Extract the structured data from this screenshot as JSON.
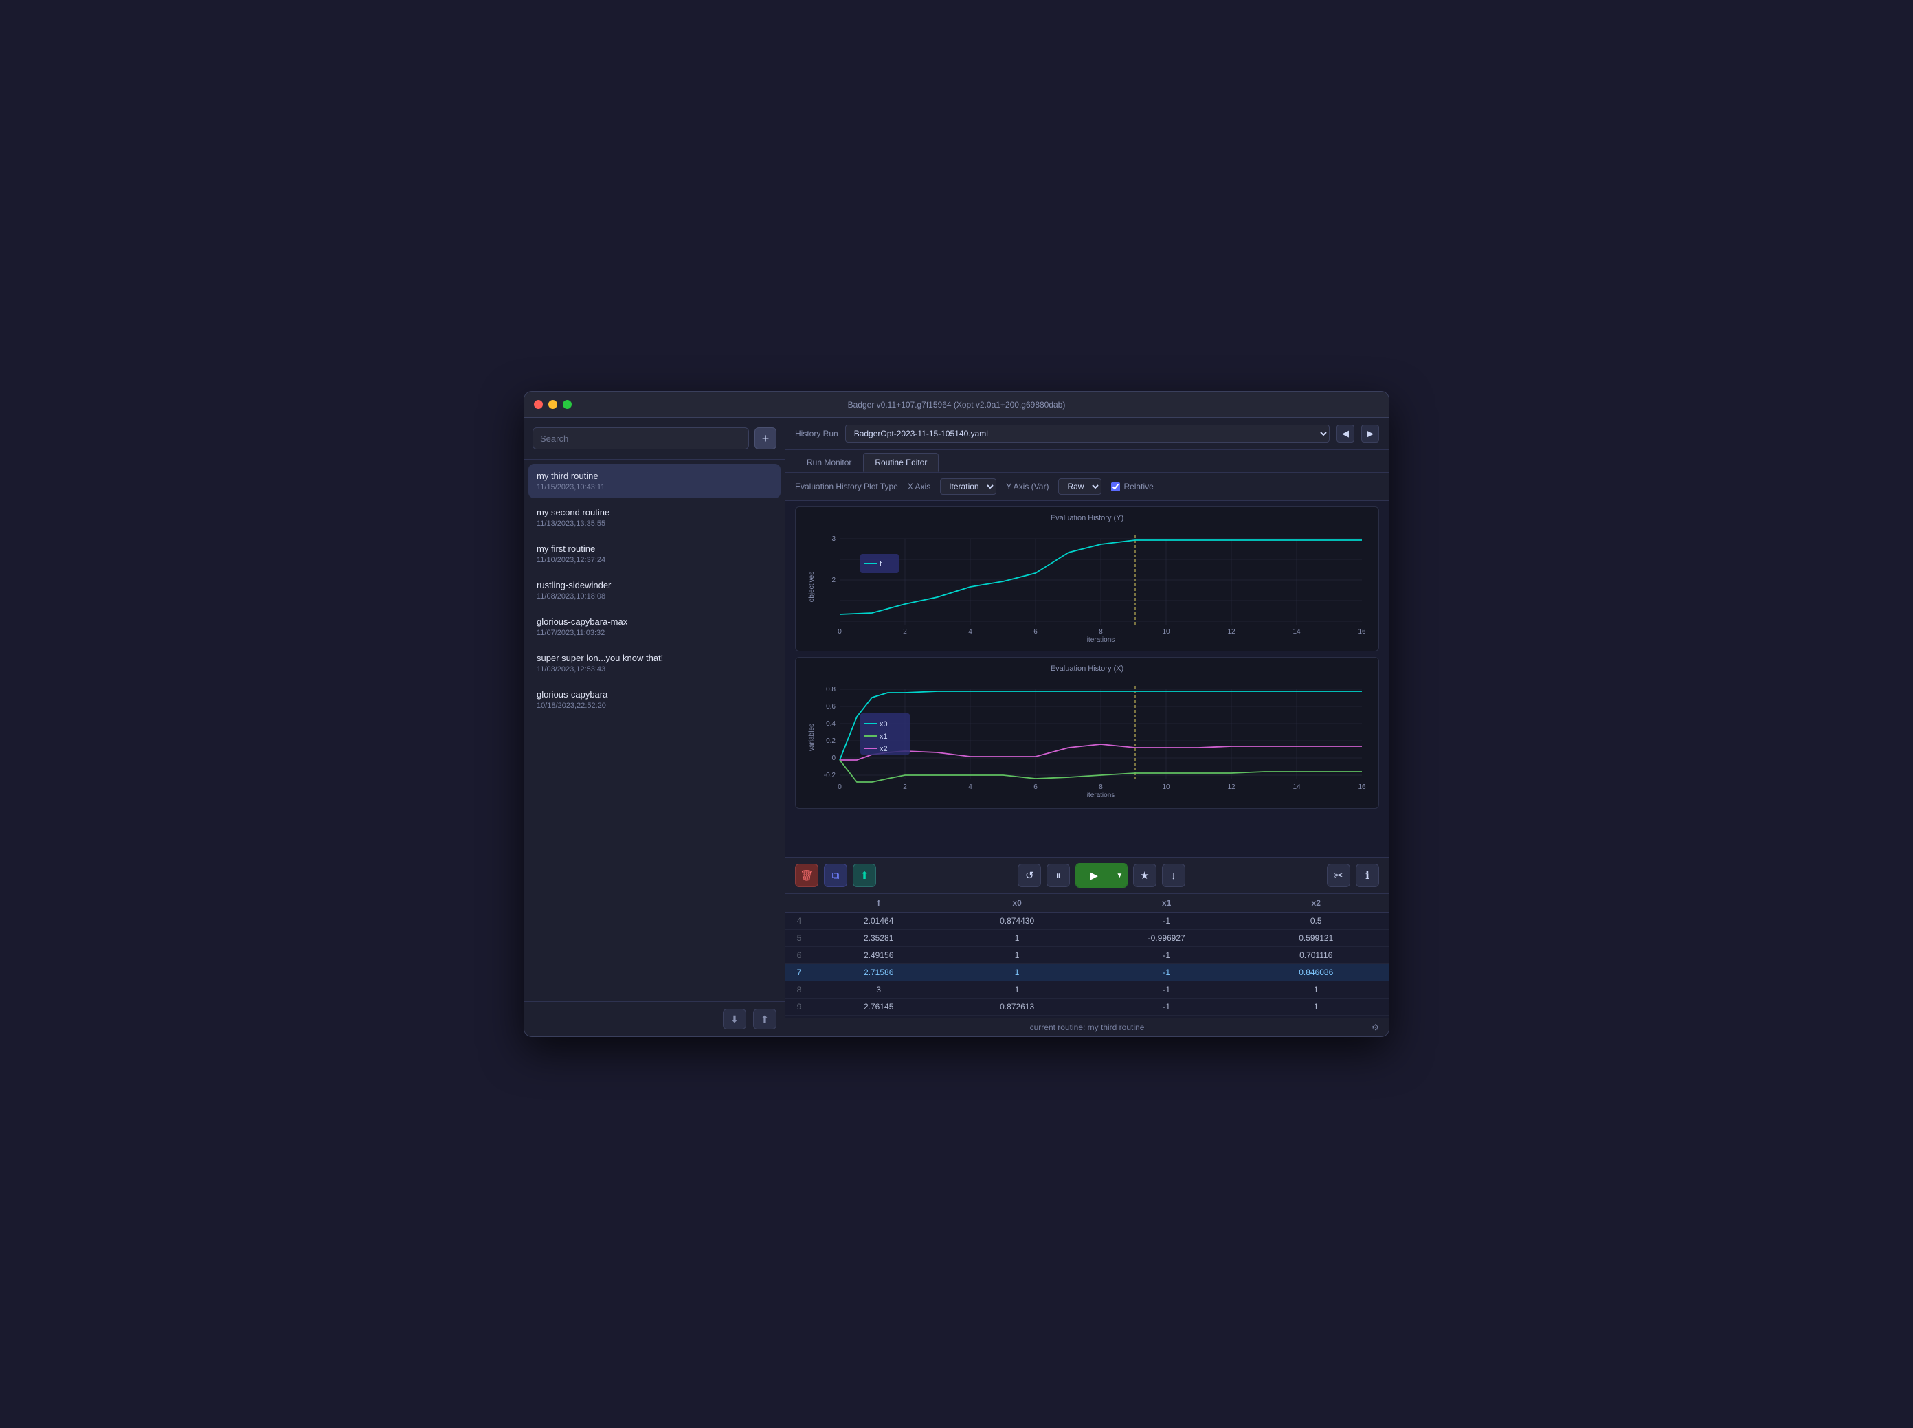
{
  "window": {
    "title": "Badger v0.11+107.g7f15964 (Xopt v2.0a1+200.g69880dab)"
  },
  "sidebar": {
    "search_placeholder": "Search",
    "add_btn_label": "+",
    "routines": [
      {
        "name": "my third routine",
        "date": "11/15/2023,10:43:11",
        "active": true
      },
      {
        "name": "my second routine",
        "date": "11/13/2023,13:35:55",
        "active": false
      },
      {
        "name": "my first routine",
        "date": "11/10/2023,12:37:24",
        "active": false
      },
      {
        "name": "rustling-sidewinder",
        "date": "11/08/2023,10:18:08",
        "active": false
      },
      {
        "name": "glorious-capybara-max",
        "date": "11/07/2023,11:03:32",
        "active": false
      },
      {
        "name": "super super lon...you know that!",
        "date": "11/03/2023,12:53:43",
        "active": false
      },
      {
        "name": "glorious-capybara",
        "date": "10/18/2023,22:52:20",
        "active": false
      }
    ]
  },
  "main": {
    "history_label": "History Run",
    "history_value": "BadgerOpt-2023-11-15-105140.yaml",
    "tabs": [
      {
        "label": "Run Monitor",
        "active": false
      },
      {
        "label": "Routine Editor",
        "active": true
      }
    ],
    "plot_controls": {
      "label": "Evaluation History Plot Type",
      "x_axis_label": "X Axis",
      "x_axis_value": "Iteration",
      "y_axis_label": "Y Axis (Var)",
      "y_axis_value": "Raw",
      "relative_label": "Relative",
      "relative_checked": true
    },
    "chart_y": {
      "title": "Evaluation History (Y)",
      "x_label": "iterations",
      "y_label": "objectives",
      "legend": [
        {
          "label": "f",
          "color": "#00d4cc"
        }
      ]
    },
    "chart_x": {
      "title": "Evaluation History (X)",
      "x_label": "iterations",
      "y_label": "variables",
      "legend": [
        {
          "label": "x0",
          "color": "#00d4cc"
        },
        {
          "label": "x1",
          "color": "#80d080"
        },
        {
          "label": "x2",
          "color": "#d060d0"
        }
      ]
    },
    "table": {
      "columns": [
        "",
        "f",
        "x0",
        "x1",
        "x2"
      ],
      "rows": [
        {
          "id": "4",
          "f": "2.01464",
          "x0": "0.874430",
          "x1": "-1",
          "x2": "0.5",
          "highlighted": false
        },
        {
          "id": "5",
          "f": "2.35281",
          "x0": "1",
          "x1": "-0.996927",
          "x2": "0.599121",
          "highlighted": false
        },
        {
          "id": "6",
          "f": "2.49156",
          "x0": "1",
          "x1": "-1",
          "x2": "0.701116",
          "highlighted": false
        },
        {
          "id": "7",
          "f": "2.71586",
          "x0": "1",
          "x1": "-1",
          "x2": "0.846086",
          "highlighted": true
        },
        {
          "id": "8",
          "f": "3",
          "x0": "1",
          "x1": "-1",
          "x2": "1",
          "highlighted": false
        },
        {
          "id": "9",
          "f": "2.76145",
          "x0": "0.872613",
          "x1": "-1",
          "x2": "1",
          "highlighted": false
        }
      ]
    },
    "status": "current routine: my third routine"
  }
}
